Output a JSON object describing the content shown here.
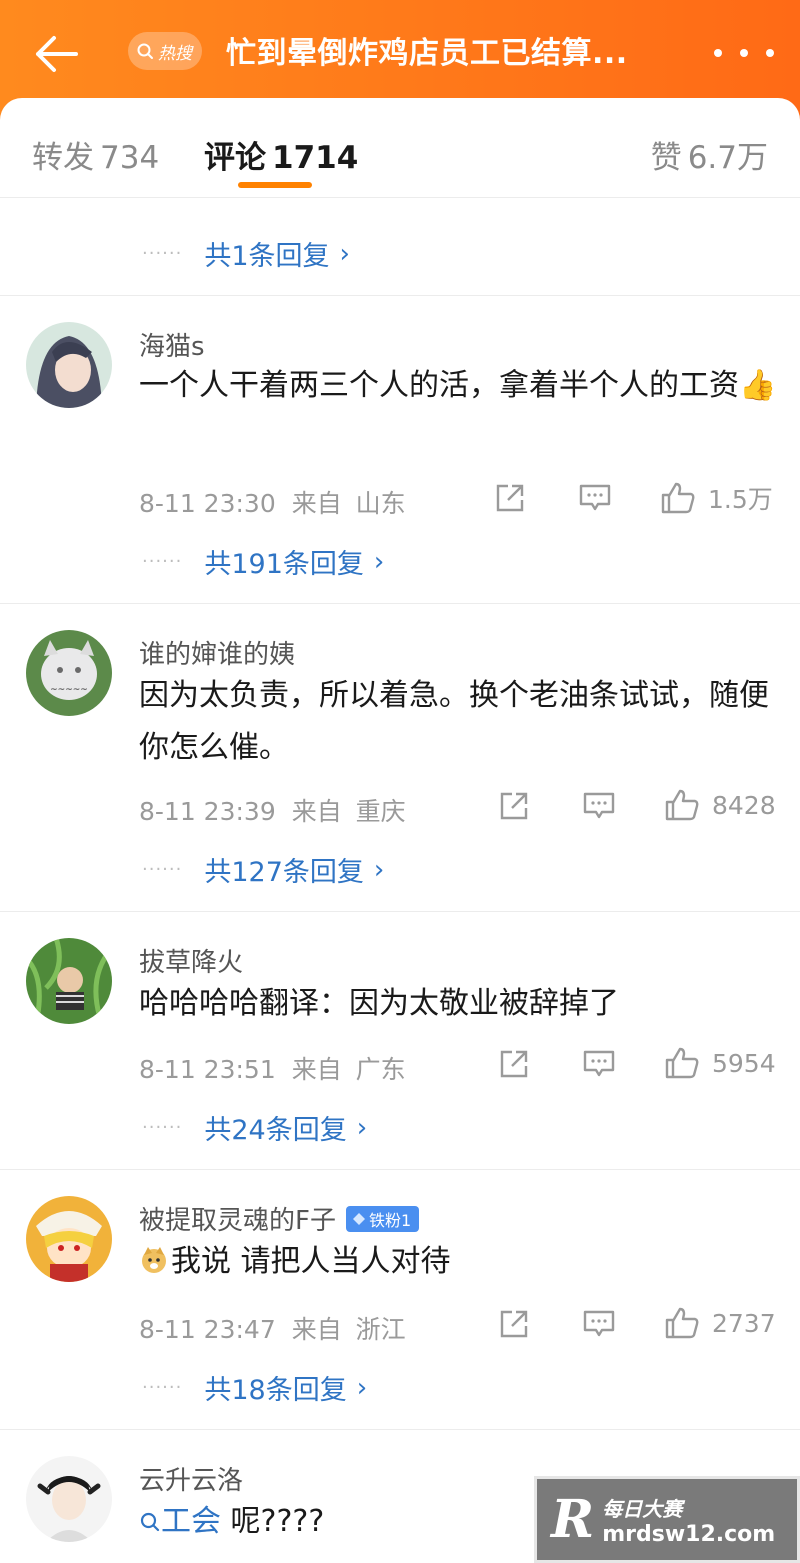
{
  "header": {
    "hot_tag": "热搜",
    "title": "忙到晕倒炸鸡店员工已结算..."
  },
  "tabs": {
    "repost_label": "转发",
    "repost_count": "734",
    "comment_label": "评论",
    "comment_count": "1714",
    "like_label": "赞",
    "like_count": "6.7万"
  },
  "partial": {
    "replies": "共1条回复"
  },
  "comments": [
    {
      "username": "海猫s",
      "text": "一个人干着两三个人的活，拿着半个人的工资👍",
      "time": "8-11 23:30",
      "from_label": "来自",
      "location": "山东",
      "likes": "1.5万",
      "replies": "共191条回复"
    },
    {
      "username": "谁的婶谁的姨",
      "text": "因为太负责，所以着急。换个老油条试试，随便你怎么催。",
      "time": "8-11 23:39",
      "from_label": "来自",
      "location": "重庆",
      "likes": "8428",
      "replies": "共127条回复"
    },
    {
      "username": "拔草降火",
      "text": "哈哈哈哈翻译：因为太敬业被辞掉了",
      "time": "8-11 23:51",
      "from_label": "来自",
      "location": "广东",
      "likes": "5954",
      "replies": "共24条回复"
    },
    {
      "username": "被提取灵魂的F子",
      "badge": "铁粉1",
      "text": "我说 请把人当人对待",
      "time": "8-11 23:47",
      "from_label": "来自",
      "location": "浙江",
      "likes": "2737",
      "replies": "共18条回复"
    },
    {
      "username": "云升云洛",
      "topic": "工会",
      "text": " 呢????"
    }
  ],
  "watermark": {
    "logo": "R",
    "name": "每日大赛",
    "url": "mrdsw12.com"
  },
  "colors": {
    "header_orange": "#ff7a1a",
    "indicator": "#ff8200",
    "link_blue": "#2f74c4",
    "badge_blue": "#4a8ff0"
  }
}
